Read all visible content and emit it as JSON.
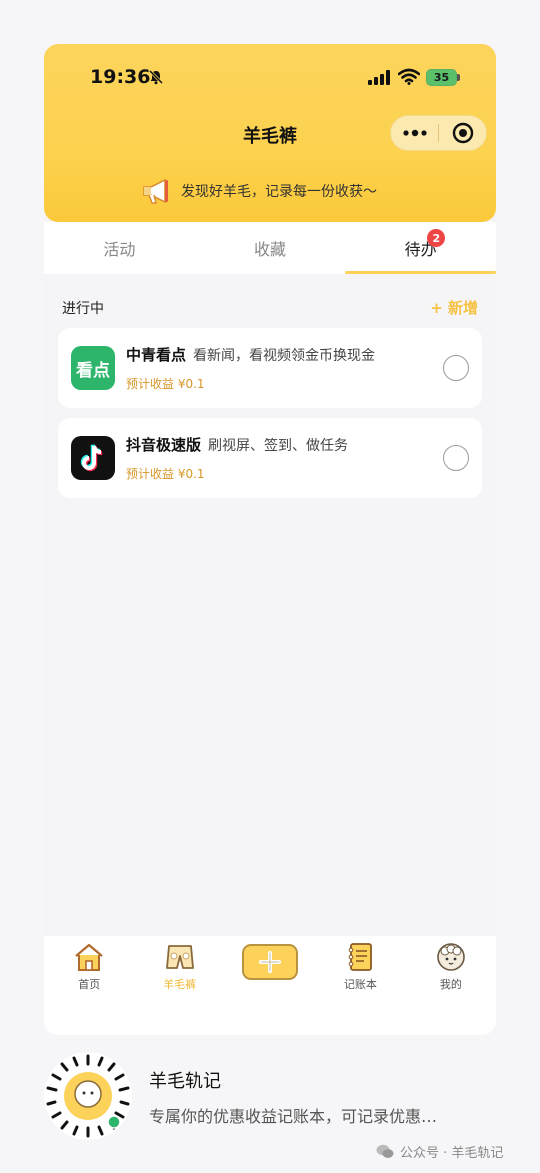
{
  "status": {
    "time": "19:36",
    "battery": "35"
  },
  "header": {
    "title": "羊毛裤",
    "tagline": "发现好羊毛，记录每一份收获～"
  },
  "tabs": [
    {
      "label": "活动"
    },
    {
      "label": "收藏"
    },
    {
      "label": "待办",
      "badge": "2"
    }
  ],
  "section": {
    "title": "进行中",
    "add_label": "+ 新增"
  },
  "todos": [
    {
      "name": "中青看点",
      "desc": "看新闻，看视频领金币换现金",
      "earn": "预计收益 ¥0.1",
      "icon_text": "看点",
      "icon": "zhongqing-kandian-icon"
    },
    {
      "name": "抖音极速版",
      "desc": "刷视屏、签到、做任务",
      "earn": "预计收益 ¥0.1",
      "icon": "douyin-icon"
    }
  ],
  "tabbar": [
    {
      "label": "首页",
      "icon": "home-icon"
    },
    {
      "label": "羊毛裤",
      "icon": "pants-icon",
      "active": true
    },
    {
      "label": "",
      "icon": "plus-icon"
    },
    {
      "label": "记账本",
      "icon": "notebook-icon"
    },
    {
      "label": "我的",
      "icon": "sheep-avatar-icon"
    }
  ],
  "footer": {
    "title": "羊毛轨记",
    "desc": "专属你的优惠收益记账本，可记录优惠…",
    "brand": "公众号 · 羊毛轨记"
  },
  "colors": {
    "accent": "#fcd25a",
    "earn": "#d8962a",
    "badge": "#ef4444"
  }
}
